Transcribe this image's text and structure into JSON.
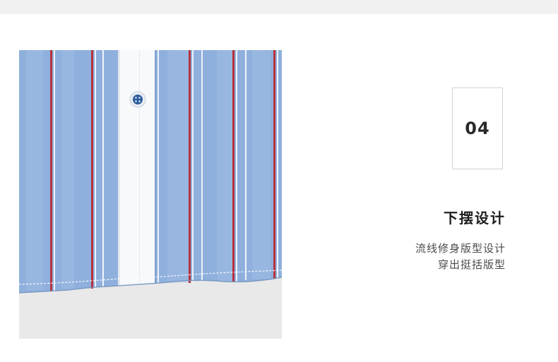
{
  "feature": {
    "number": "04",
    "title": "下摆设计",
    "description_lines": [
      "流线修身版型设计",
      "穿出挺括版型"
    ]
  },
  "colors": {
    "shirt_blue": "#8fb0dc",
    "stripe_red": "#b8323c",
    "placket_white": "#f7f9fb",
    "background_gray": "#e9e9e9",
    "button_blue": "#2a5c9c"
  },
  "icons": {
    "shirt_button": "button-icon"
  }
}
